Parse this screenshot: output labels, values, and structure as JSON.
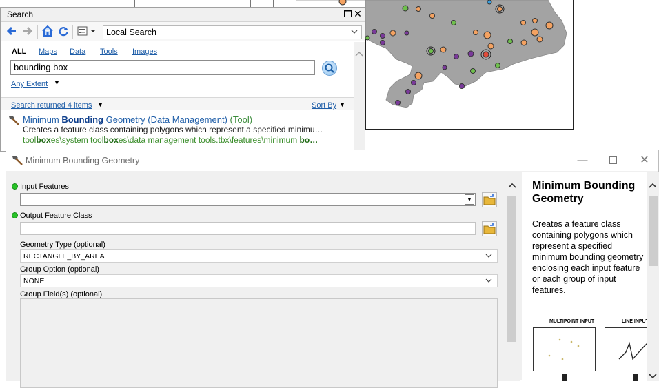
{
  "search": {
    "title": "Search",
    "location": "Local Search",
    "tabs": [
      {
        "label": "ALL",
        "active": true
      },
      {
        "label": "Maps"
      },
      {
        "label": "Data"
      },
      {
        "label": "Tools"
      },
      {
        "label": "Images"
      }
    ],
    "query": "bounding box",
    "extent": "Any Extent",
    "results_count": "Search returned 4 items",
    "sort_by": "Sort By",
    "result": {
      "title_pre": "Minimum ",
      "title_bold": "Bounding",
      "title_post": " Geometry (Data Management)",
      "type": "(Tool)",
      "description": "Creates a feature class containing polygons which represent a specified minimu…",
      "path_parts": [
        "tool",
        "box",
        "es\\system tool",
        "box",
        "es\\data management tools.tbx\\features\\minimum ",
        "bo…"
      ]
    }
  },
  "dialog": {
    "title": "Minimum Bounding Geometry",
    "params": {
      "input_features": {
        "label": "Input Features",
        "value": ""
      },
      "output_feature_class": {
        "label": "Output Feature Class",
        "value": ""
      },
      "geometry_type": {
        "label": "Geometry Type (optional)",
        "value": "RECTANGLE_BY_AREA"
      },
      "group_option": {
        "label": "Group Option (optional)",
        "value": "NONE"
      },
      "group_fields": {
        "label": "Group Field(s) (optional)"
      }
    },
    "help": {
      "title": "Minimum Bounding Geometry",
      "body": "Creates a feature class containing polygons which represent a specified minimum bounding geometry enclosing each input feature or each group of input features.",
      "figure_captions": [
        "MULTIPOINT INPUT",
        "LINE INPUT"
      ]
    }
  },
  "icons": [
    "back-arrow-icon",
    "forward-arrow-icon",
    "home-icon",
    "refresh-icon",
    "view-options-icon",
    "search-go-icon",
    "tool-hammer-icon",
    "folder-browse-icon",
    "minimize-icon",
    "maximize-icon",
    "close-icon"
  ],
  "colors": {
    "link": "#1f5ea8",
    "path_green": "#3a8d2a",
    "required_dot": "#27c227",
    "map_land": "#a3a3a3"
  }
}
